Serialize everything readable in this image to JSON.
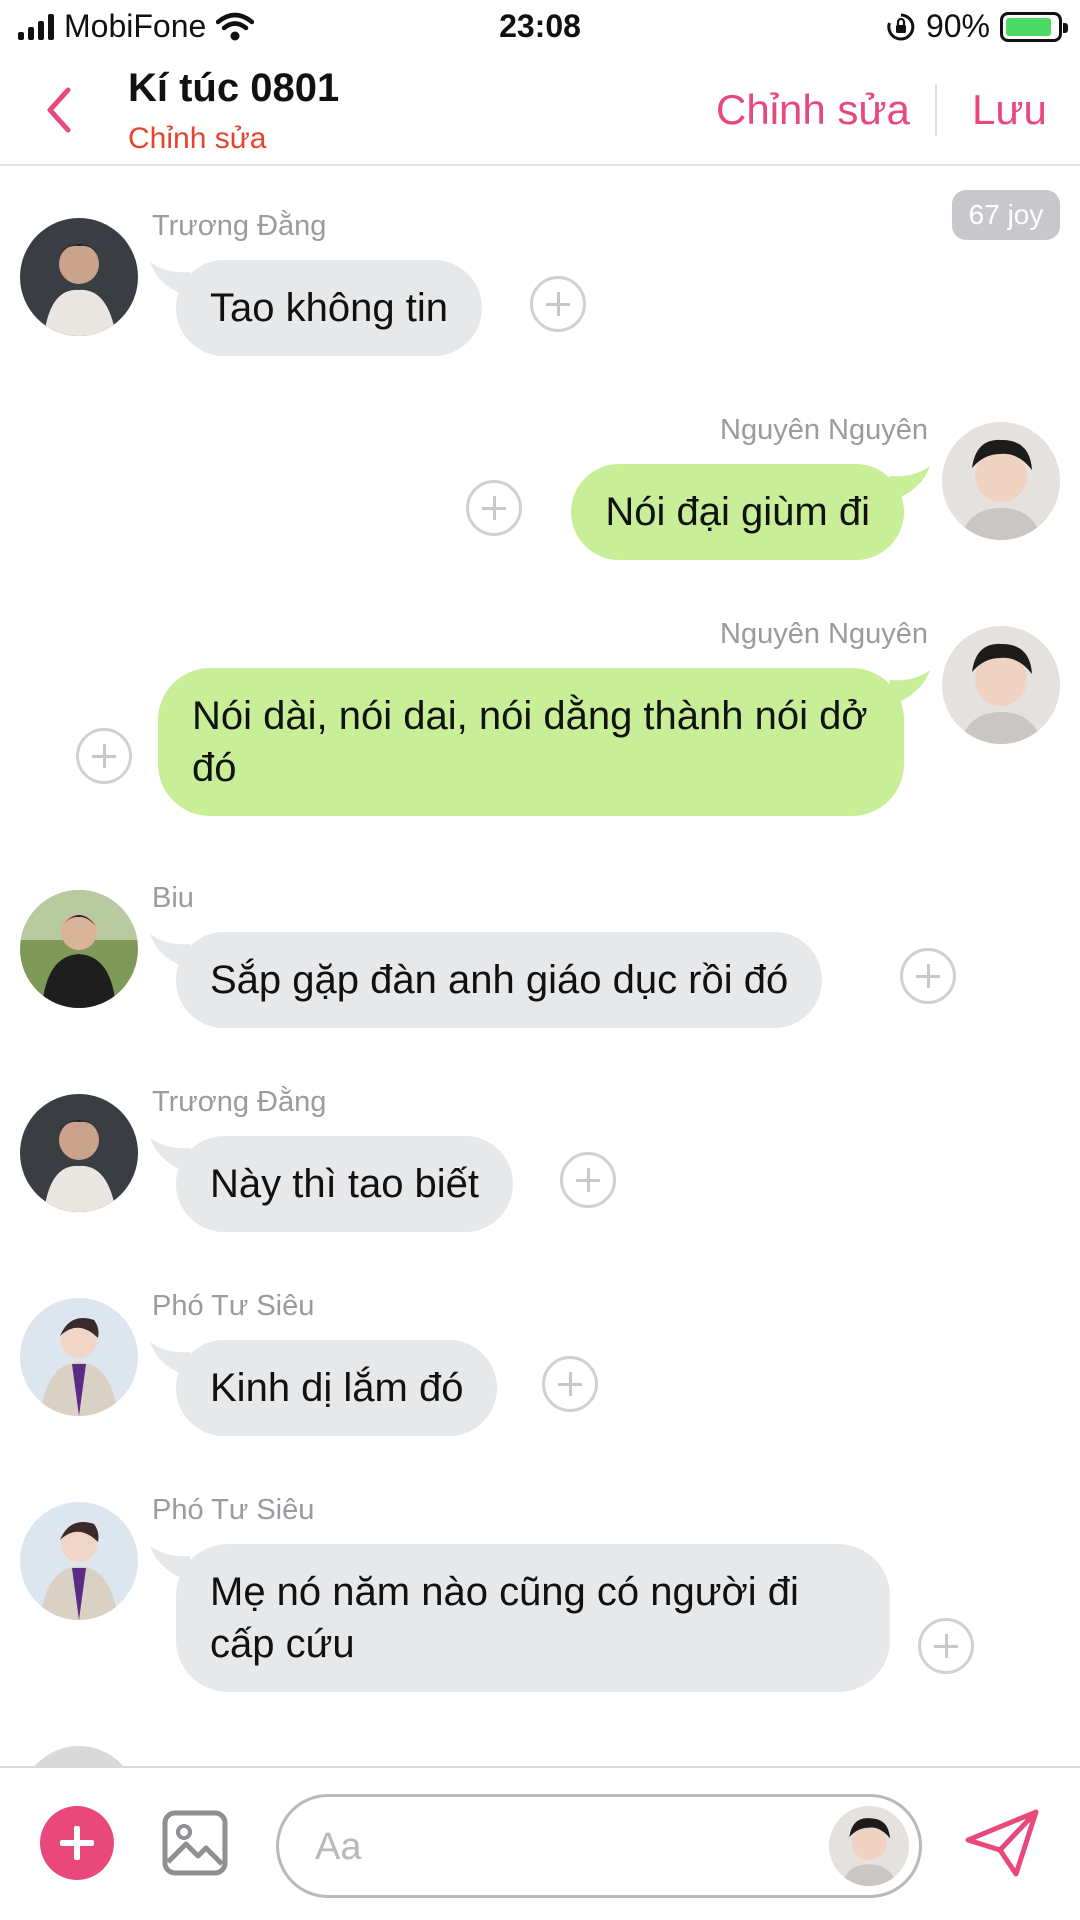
{
  "status_bar": {
    "carrier": "MobiFone",
    "time": "23:08",
    "battery": "90%",
    "battery_level": 0.9
  },
  "header": {
    "title": "Kí túc 0801",
    "subtitle": "Chỉnh sửa",
    "edit_label": "Chỉnh sửa",
    "save_label": "Lưu"
  },
  "chat": {
    "joy_badge": "67 joy",
    "messages": [
      {
        "sender": "Trương Đằng",
        "text": "Tao không tin",
        "direction": "incoming"
      },
      {
        "sender": "Nguyên Nguyên",
        "text": "Nói đại giùm đi",
        "direction": "outgoing"
      },
      {
        "sender": "Nguyên Nguyên",
        "text": "Nói dài, nói dai, nói dằng thành nói dở đó",
        "direction": "outgoing"
      },
      {
        "sender": "Biu",
        "text": "Sắp gặp đàn anh giáo dục rồi đó",
        "direction": "incoming"
      },
      {
        "sender": "Trương Đằng",
        "text": "Này thì tao biết",
        "direction": "incoming"
      },
      {
        "sender": "Phó Tư Siêu",
        "text": "Kinh dị lắm đó",
        "direction": "incoming"
      },
      {
        "sender": "Phó Tư Siêu",
        "text": "Mẹ nó năm nào cũng có người đi cấp cứu",
        "direction": "incoming"
      }
    ]
  },
  "composer": {
    "placeholder": "Aa"
  },
  "colors": {
    "accent": "#e8497a",
    "subtitle": "#e8432c",
    "incoming_bubble": "#e6e8ea",
    "outgoing_bubble": "#c8ef98"
  },
  "icons": [
    "back-chevron-icon",
    "plus-icon",
    "image-icon",
    "send-icon",
    "add-reaction-icon"
  ]
}
